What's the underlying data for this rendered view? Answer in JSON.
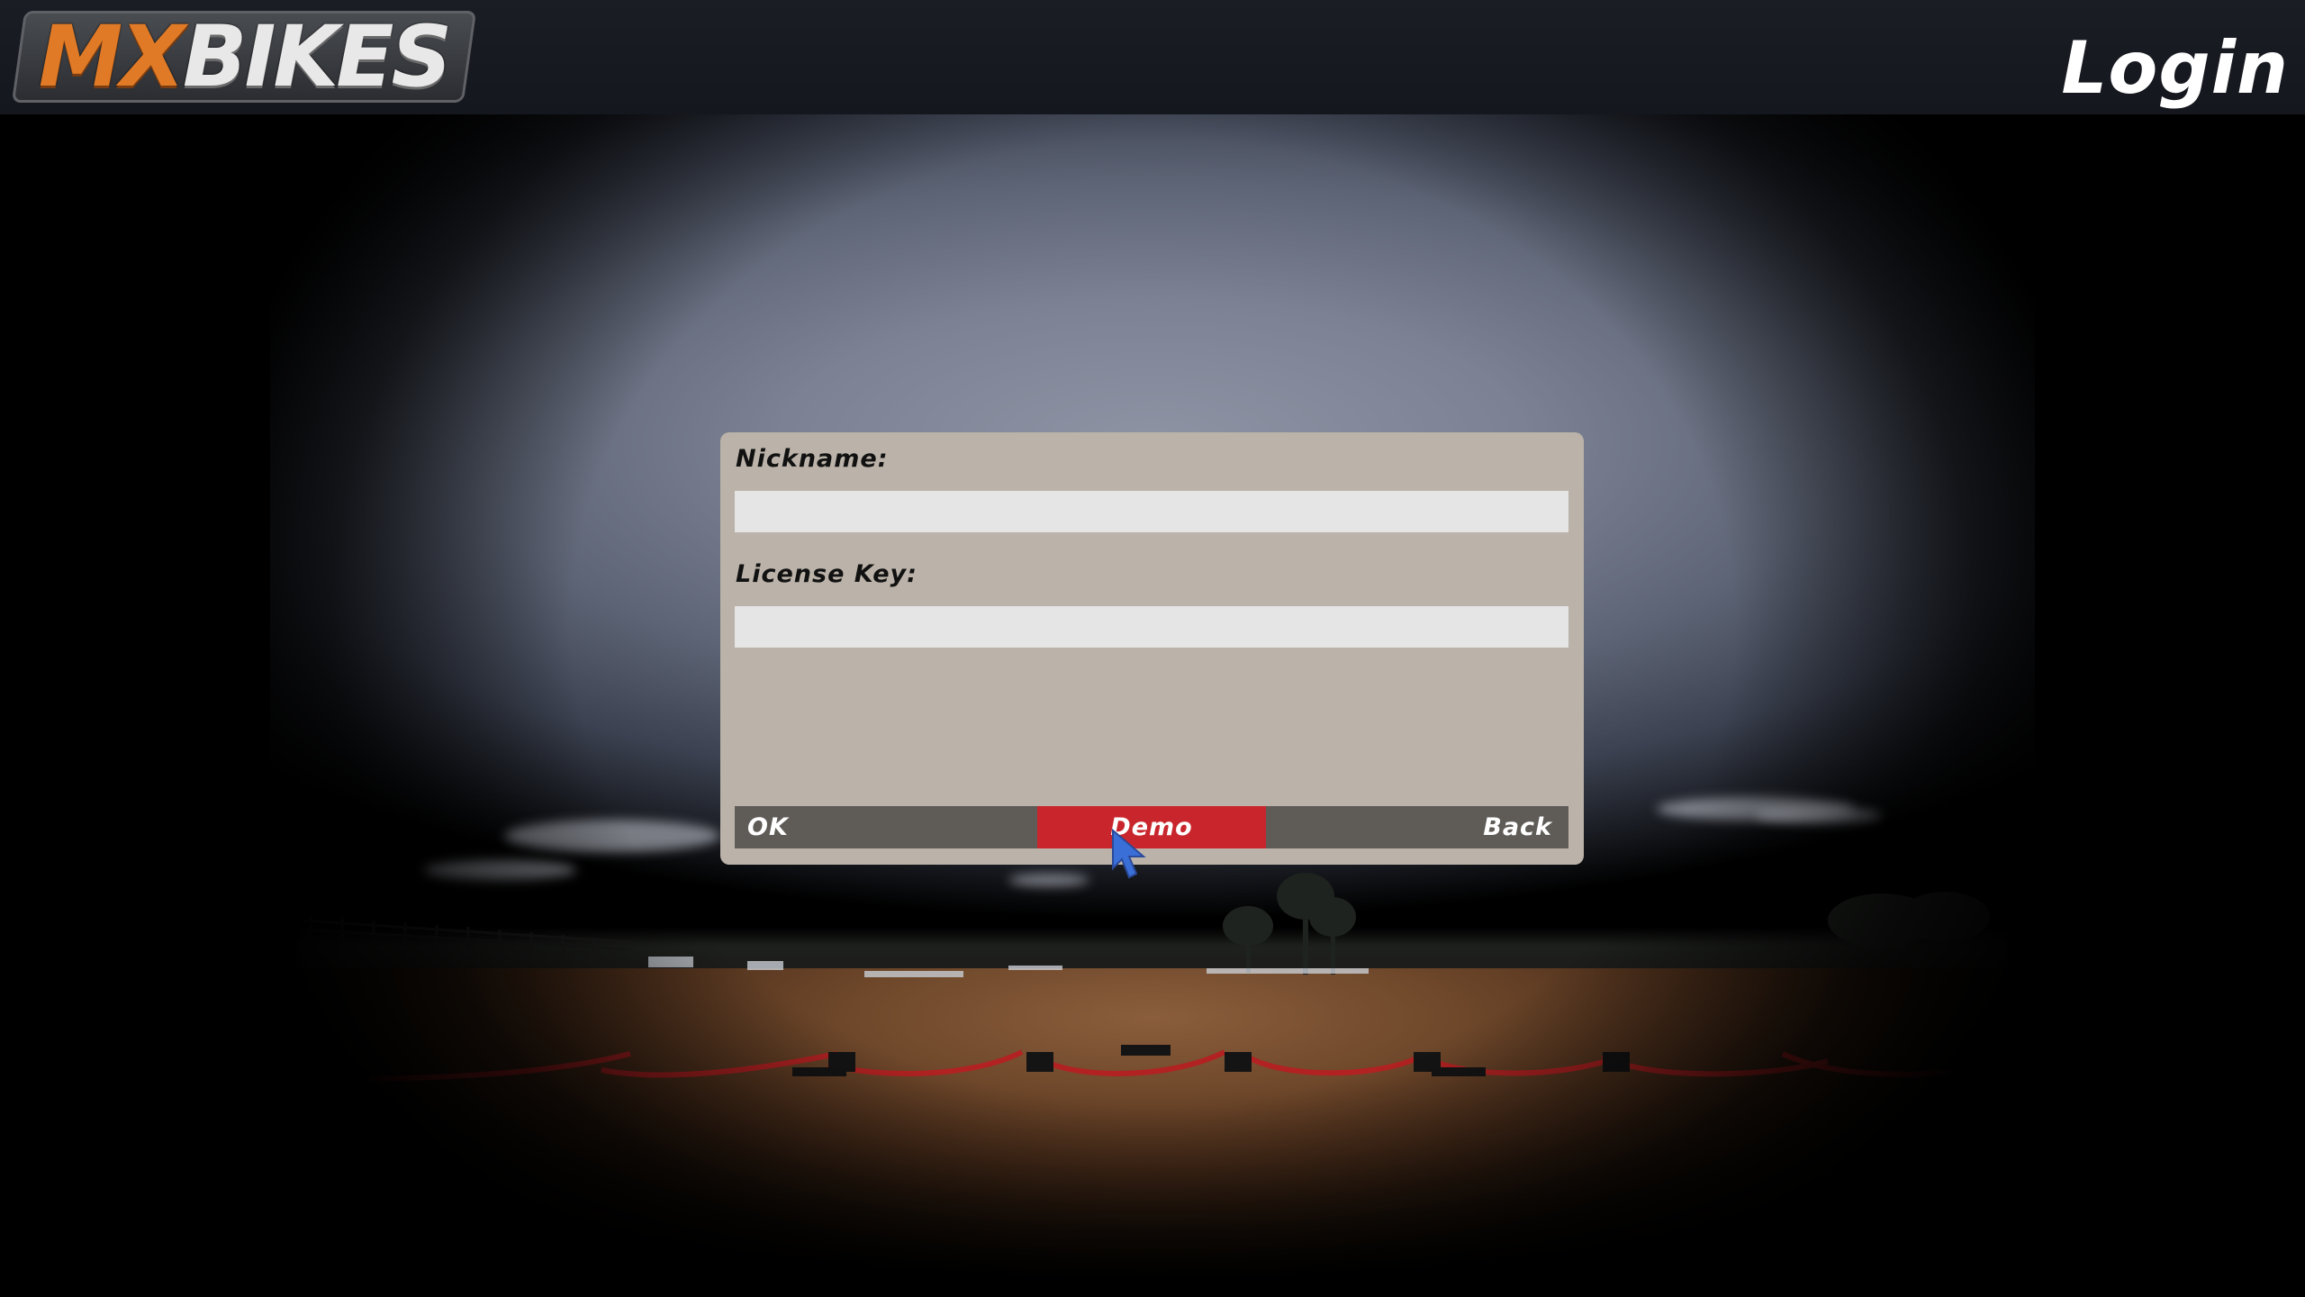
{
  "header": {
    "logo": {
      "mx": "MX",
      "bikes": "BIKES"
    },
    "title": "Login"
  },
  "login_dialog": {
    "nickname": {
      "label": "Nickname:",
      "value": "",
      "placeholder": ""
    },
    "license_key": {
      "label": "License Key:",
      "value": "",
      "placeholder": ""
    },
    "buttons": {
      "ok": "OK",
      "demo": "Demo",
      "back": "Back"
    }
  },
  "colors": {
    "dialog_background": "#bbb3a9",
    "input_background": "#e5e5e5",
    "button_bar": "#5f5b57",
    "demo_highlight": "#c8262c",
    "logo_orange": "#e07a26",
    "cursor_blue": "#3b6fd8"
  },
  "icons": {
    "cursor": "mouse-pointer-icon"
  }
}
